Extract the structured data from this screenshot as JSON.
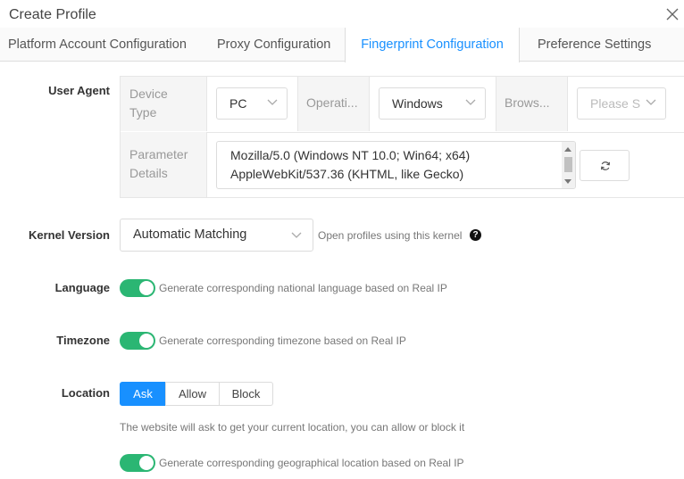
{
  "dialog": {
    "title": "Create Profile"
  },
  "tabs": [
    {
      "label": "Platform Account Configuration",
      "active": false
    },
    {
      "label": "Proxy Configuration",
      "active": false
    },
    {
      "label": "Fingerprint Configuration",
      "active": true
    },
    {
      "label": "Preference Settings",
      "active": false
    }
  ],
  "user_agent": {
    "label": "User Agent",
    "device_type_label": "Device Type",
    "device_type_value": "PC",
    "os_label": "Operati...",
    "os_value": "Windows",
    "browser_label": "Brows...",
    "browser_placeholder": "Please S",
    "param_label": "Parameter Details",
    "param_line1": "Mozilla/5.0 (Windows NT 10.0; Win64; x64)",
    "param_line2": "AppleWebKit/537.36 (KHTML, like Gecko)"
  },
  "kernel": {
    "label": "Kernel Version",
    "value": "Automatic Matching",
    "hint": "Open profiles using this kernel"
  },
  "language": {
    "label": "Language",
    "enabled": true,
    "hint": "Generate corresponding national language based on Real IP"
  },
  "timezone": {
    "label": "Timezone",
    "enabled": true,
    "hint": "Generate corresponding timezone based on Real IP"
  },
  "location": {
    "label": "Location",
    "options": [
      "Ask",
      "Allow",
      "Block"
    ],
    "selected": "Ask",
    "description": "The website will ask to get your current location, you can allow or block it",
    "geo_enabled": true,
    "geo_hint": "Generate corresponding geographical location based on Real IP"
  },
  "colors": {
    "accent": "#1890ff",
    "toggle_on": "#2bb673"
  }
}
